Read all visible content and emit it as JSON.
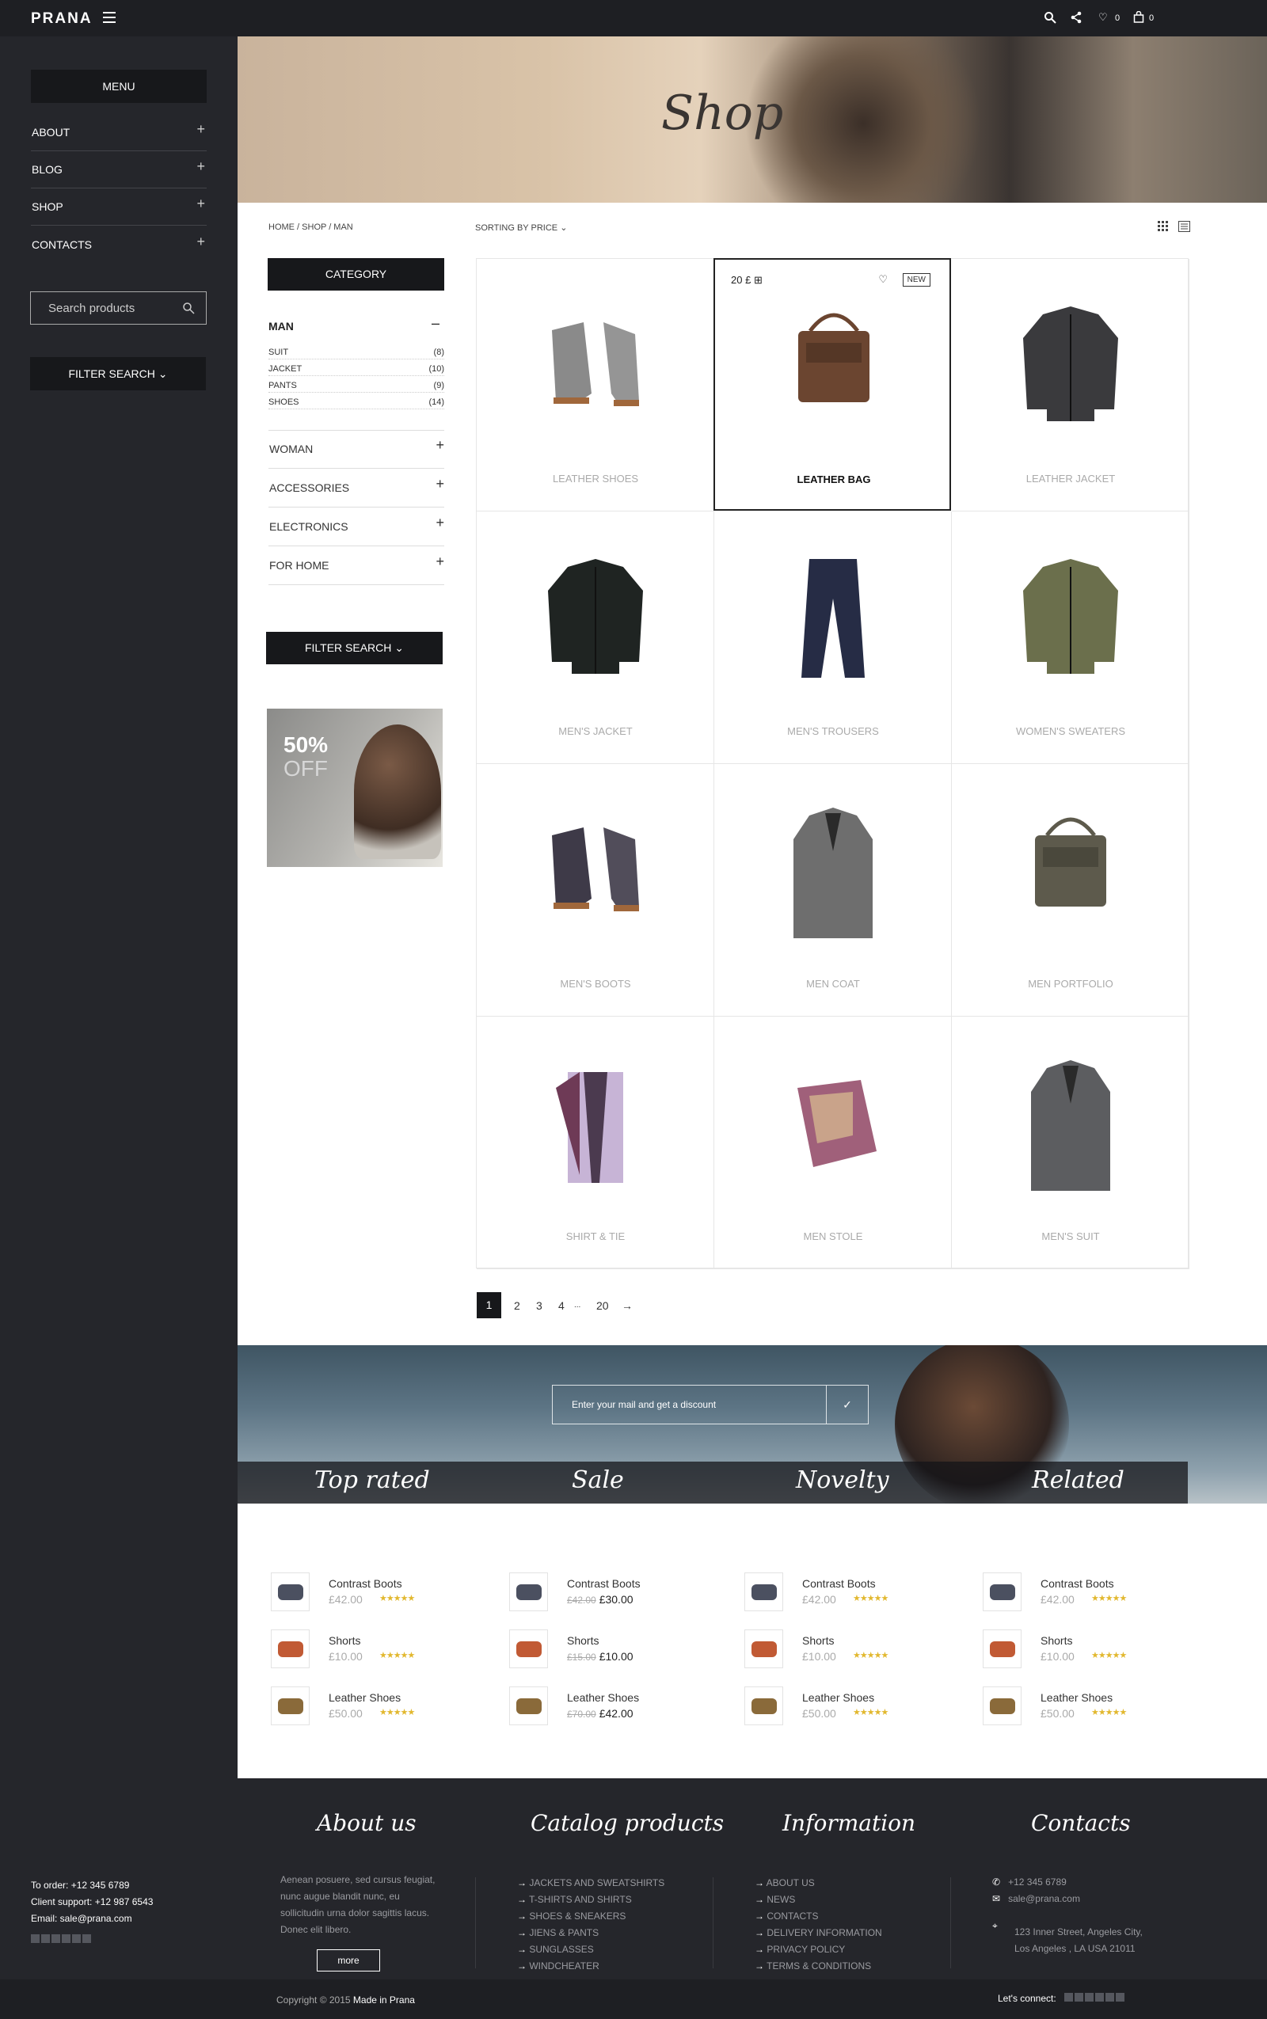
{
  "header": {
    "logo": "PRANA",
    "wishlist_count": "0",
    "cart_count": "0"
  },
  "sidebar": {
    "menu_label": "MENU",
    "items": [
      {
        "label": "ABOUT"
      },
      {
        "label": "BLOG"
      },
      {
        "label": "SHOP"
      },
      {
        "label": "CONTACTS"
      }
    ],
    "search_placeholder": "Search products",
    "filter_label": "FILTER SEARCH",
    "contacts": {
      "order": "To order: +12 345 6789",
      "support": "Client support: +12 987 6543",
      "email": "Email: sale@prana.com"
    }
  },
  "hero": {
    "title": "Shop"
  },
  "toolbar": {
    "breadcrumb": "HOME / SHOP / MAN",
    "sorting": "SORTING BY PRICE"
  },
  "categories": {
    "button": "CATEGORY",
    "active": "MAN",
    "subitems": [
      {
        "label": "SUIT",
        "count": "(8)"
      },
      {
        "label": "JACKET",
        "count": "(10)"
      },
      {
        "label": "PANTS",
        "count": "(9)"
      },
      {
        "label": "SHOES",
        "count": "(14)"
      }
    ],
    "items": [
      {
        "label": "WOMAN"
      },
      {
        "label": "ACCESSORIES"
      },
      {
        "label": "ELECTRONICS"
      },
      {
        "label": "FOR HOME"
      }
    ],
    "filter_label": "FILTER SEARCH"
  },
  "promo": {
    "percent": "50%",
    "off": "OFF"
  },
  "products": [
    {
      "name": "LEATHER SHOES",
      "icon": "shoes",
      "color": "#8a8a8a"
    },
    {
      "name": "LEATHER BAG",
      "icon": "bag",
      "color": "#6b4530",
      "price": "20 £",
      "badge": "NEW"
    },
    {
      "name": "LEATHER JACKET",
      "icon": "jacket",
      "color": "#3a3a3d"
    },
    {
      "name": "MEN'S JACKET",
      "icon": "jacket",
      "color": "#1f2422"
    },
    {
      "name": "MEN'S TROUSERS",
      "icon": "trousers",
      "color": "#262c45"
    },
    {
      "name": "WOMEN'S SWEATERS",
      "icon": "jacket",
      "color": "#6b6f4c"
    },
    {
      "name": "MEN'S BOOTS",
      "icon": "shoes",
      "color": "#3e3a48"
    },
    {
      "name": "MEN COAT",
      "icon": "coat",
      "color": "#6e6e6e"
    },
    {
      "name": "MEN PORTFOLIO",
      "icon": "bag",
      "color": "#5d5a4c"
    },
    {
      "name": "SHIRT & TIE",
      "icon": "shirt",
      "color": "#c7b4d6"
    },
    {
      "name": "MEN STOLE",
      "icon": "scarf",
      "color": "#a0607a"
    },
    {
      "name": "MEN'S SUIT",
      "icon": "coat",
      "color": "#5c5d60"
    }
  ],
  "pagination": {
    "pages": [
      "1",
      "2",
      "3",
      "4",
      "...",
      "20"
    ],
    "next": "→"
  },
  "newsletter": {
    "placeholder": "Enter your mail and get a discount"
  },
  "tabs": [
    "Top rated",
    "Sale",
    "Novelty",
    "Related"
  ],
  "lists": [
    [
      {
        "name": "Contrast Boots",
        "price": "£42.00"
      },
      {
        "name": "Shorts",
        "price": "£10.00"
      },
      {
        "name": "Leather Shoes",
        "price": "£50.00"
      }
    ],
    [
      {
        "name": "Contrast Boots",
        "old": "£42.00",
        "price": "£30.00"
      },
      {
        "name": "Shorts",
        "old": "£15.00",
        "price": "£10.00"
      },
      {
        "name": "Leather Shoes",
        "old": "£70.00",
        "price": "£42.00"
      }
    ],
    [
      {
        "name": "Contrast Boots",
        "price": "£42.00"
      },
      {
        "name": "Shorts",
        "price": "£10.00"
      },
      {
        "name": "Leather Shoes",
        "price": "£50.00"
      }
    ],
    [
      {
        "name": "Contrast Boots",
        "price": "£42.00"
      },
      {
        "name": "Shorts",
        "price": "£10.00"
      },
      {
        "name": "Leather Shoes",
        "price": "£50.00"
      }
    ]
  ],
  "footer": {
    "about_title": "About us",
    "about_text": "Aenean posuere, sed cursus feugiat, nunc augue blandit nunc, eu sollicitudin urna dolor sagittis lacus. Donec elit libero.",
    "more": "more",
    "catalog_title": "Catalog products",
    "catalog": [
      "JACKETS AND SWEATSHIRTS",
      "T-SHIRTS AND SHIRTS",
      "SHOES & SNEAKERS",
      "JIENS & PANTS",
      "SUNGLASSES",
      "WINDCHEATER"
    ],
    "info_title": "Information",
    "info": [
      "ABOUT US",
      "NEWS",
      "CONTACTS",
      "DELIVERY INFORMATION",
      "PRIVACY POLICY",
      "TERMS & CONDITIONS"
    ],
    "contacts_title": "Contacts",
    "phone": "+12 345 6789",
    "email": "sale@prana.com",
    "address1": "123 Inner Street, Angeles City,",
    "address2": "Los Angeles , LA USA 21011",
    "copyright": "Copyright © 2015",
    "made": "Made in Prana",
    "connect": "Let's connect:"
  }
}
